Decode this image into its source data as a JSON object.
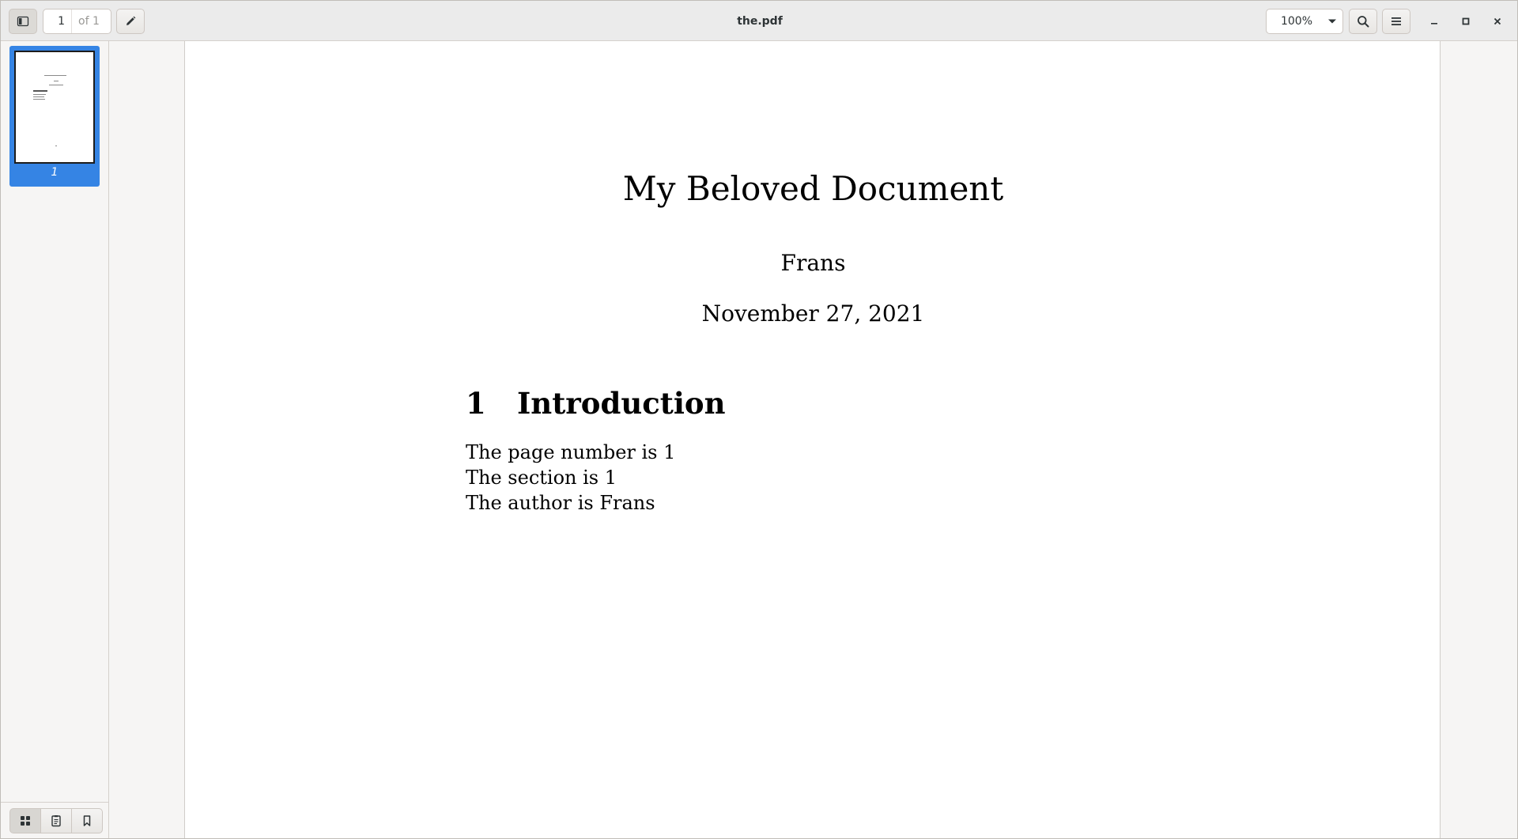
{
  "window": {
    "title": "the.pdf"
  },
  "toolbar": {
    "current_page": "1",
    "total_pages": "of 1",
    "zoom": "100%"
  },
  "sidebar": {
    "thumbnails": [
      {
        "label": "1",
        "selected": true
      }
    ]
  },
  "document": {
    "title": "My Beloved Document",
    "author": "Frans",
    "date": "November 27, 2021",
    "section_number": "1",
    "section_title": "Introduction",
    "lines": [
      "The page number is 1",
      "The section is 1",
      "The author is Frans"
    ]
  },
  "colors": {
    "accent": "#3584e4",
    "headerbar": "#ebebeb",
    "background": "#f6f5f4"
  },
  "icons": {
    "sidebar_toggle": "sidebar-toggle-icon",
    "annotate": "pencil-icon",
    "zoom_menu": "chevron-down-icon",
    "search": "search-icon",
    "menu": "hamburger-menu-icon",
    "minimize": "minimize-icon",
    "maximize": "maximize-icon",
    "close": "close-icon",
    "thumbnails_tab": "grid-icon",
    "outline_tab": "document-outline-icon",
    "bookmarks_tab": "bookmark-icon"
  }
}
